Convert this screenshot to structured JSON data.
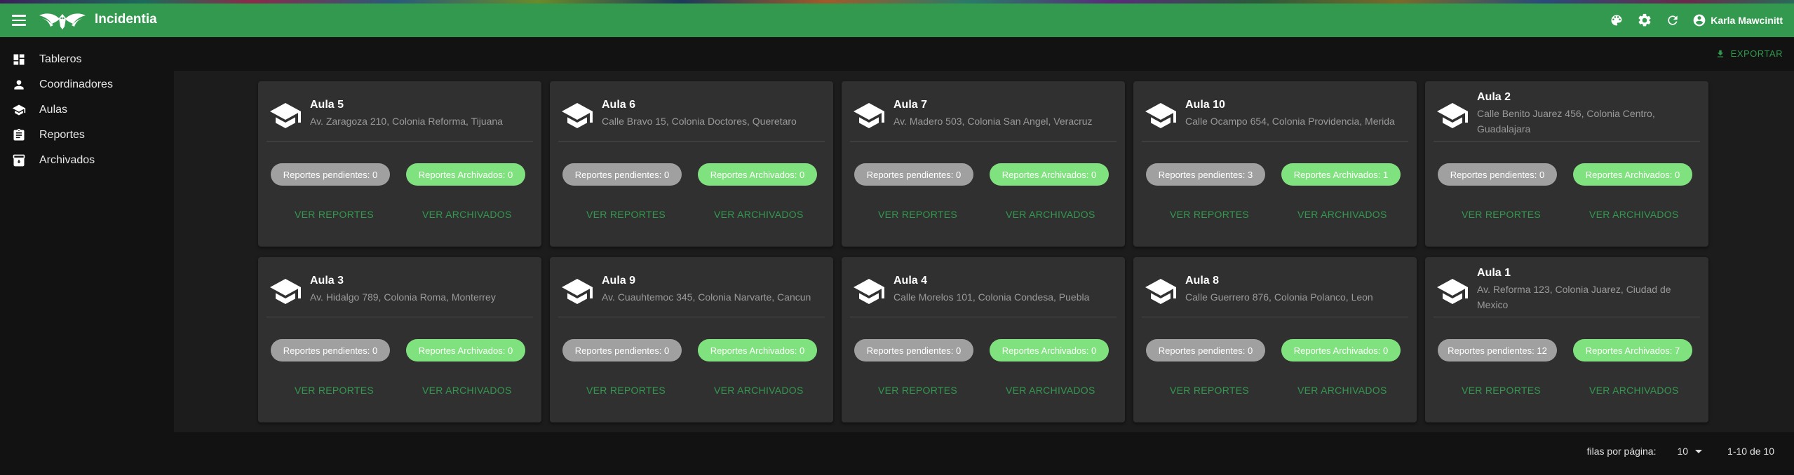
{
  "app": {
    "title": "Incidentia"
  },
  "user": {
    "name": "Karla Mawcinitt"
  },
  "nav": [
    {
      "label": "Tableros",
      "icon": "dashboard-icon"
    },
    {
      "label": "Coordinadores",
      "icon": "person-icon"
    },
    {
      "label": "Aulas",
      "icon": "school-icon"
    },
    {
      "label": "Reportes",
      "icon": "clipboard-icon"
    },
    {
      "label": "Archivados",
      "icon": "archive-icon"
    }
  ],
  "toolbar": {
    "export_label": "EXPORTAR"
  },
  "card_labels": {
    "view_reports": "VER REPORTES",
    "view_archived": "VER ARCHIVADOS"
  },
  "cards": [
    {
      "title": "Aula 5",
      "address": "Av. Zaragoza 210, Colonia Reforma, Tijuana",
      "pending": "Reportes pendientes: 0",
      "archived": "Reportes Archivados: 0"
    },
    {
      "title": "Aula 6",
      "address": "Calle Bravo 15, Colonia Doctores, Queretaro",
      "pending": "Reportes pendientes: 0",
      "archived": "Reportes Archivados: 0"
    },
    {
      "title": "Aula 7",
      "address": "Av. Madero 503, Colonia San Angel, Veracruz",
      "pending": "Reportes pendientes: 0",
      "archived": "Reportes Archivados: 0"
    },
    {
      "title": "Aula 10",
      "address": "Calle Ocampo 654, Colonia Providencia, Merida",
      "pending": "Reportes pendientes: 3",
      "archived": "Reportes Archivados: 1"
    },
    {
      "title": "Aula 2",
      "address": "Calle Benito Juarez 456, Colonia Centro, Guadalajara",
      "pending": "Reportes pendientes: 0",
      "archived": "Reportes Archivados: 0"
    },
    {
      "title": "Aula 3",
      "address": "Av. Hidalgo 789, Colonia Roma, Monterrey",
      "pending": "Reportes pendientes: 0",
      "archived": "Reportes Archivados: 0"
    },
    {
      "title": "Aula 9",
      "address": "Av. Cuauhtemoc 345, Colonia Narvarte, Cancun",
      "pending": "Reportes pendientes: 0",
      "archived": "Reportes Archivados: 0"
    },
    {
      "title": "Aula 4",
      "address": "Calle Morelos 101, Colonia Condesa, Puebla",
      "pending": "Reportes pendientes: 0",
      "archived": "Reportes Archivados: 0"
    },
    {
      "title": "Aula 8",
      "address": "Calle Guerrero 876, Colonia Polanco, Leon",
      "pending": "Reportes pendientes: 0",
      "archived": "Reportes Archivados: 0"
    },
    {
      "title": "Aula 1",
      "address": "Av. Reforma 123, Colonia Juarez, Ciudad de Mexico",
      "pending": "Reportes pendientes: 12",
      "archived": "Reportes Archivados: 7"
    }
  ],
  "pagination": {
    "rows_label": "filas por página:",
    "rows_value": "10",
    "range": "1-10 de 10"
  },
  "colors": {
    "appbar": "#33994f",
    "accent": "#33994f",
    "chip_pending": "#a0a0a0",
    "chip_archived": "#80e27e",
    "card_bg": "#303030",
    "panel_bg": "#1c1c1c",
    "page_bg": "#121212"
  }
}
